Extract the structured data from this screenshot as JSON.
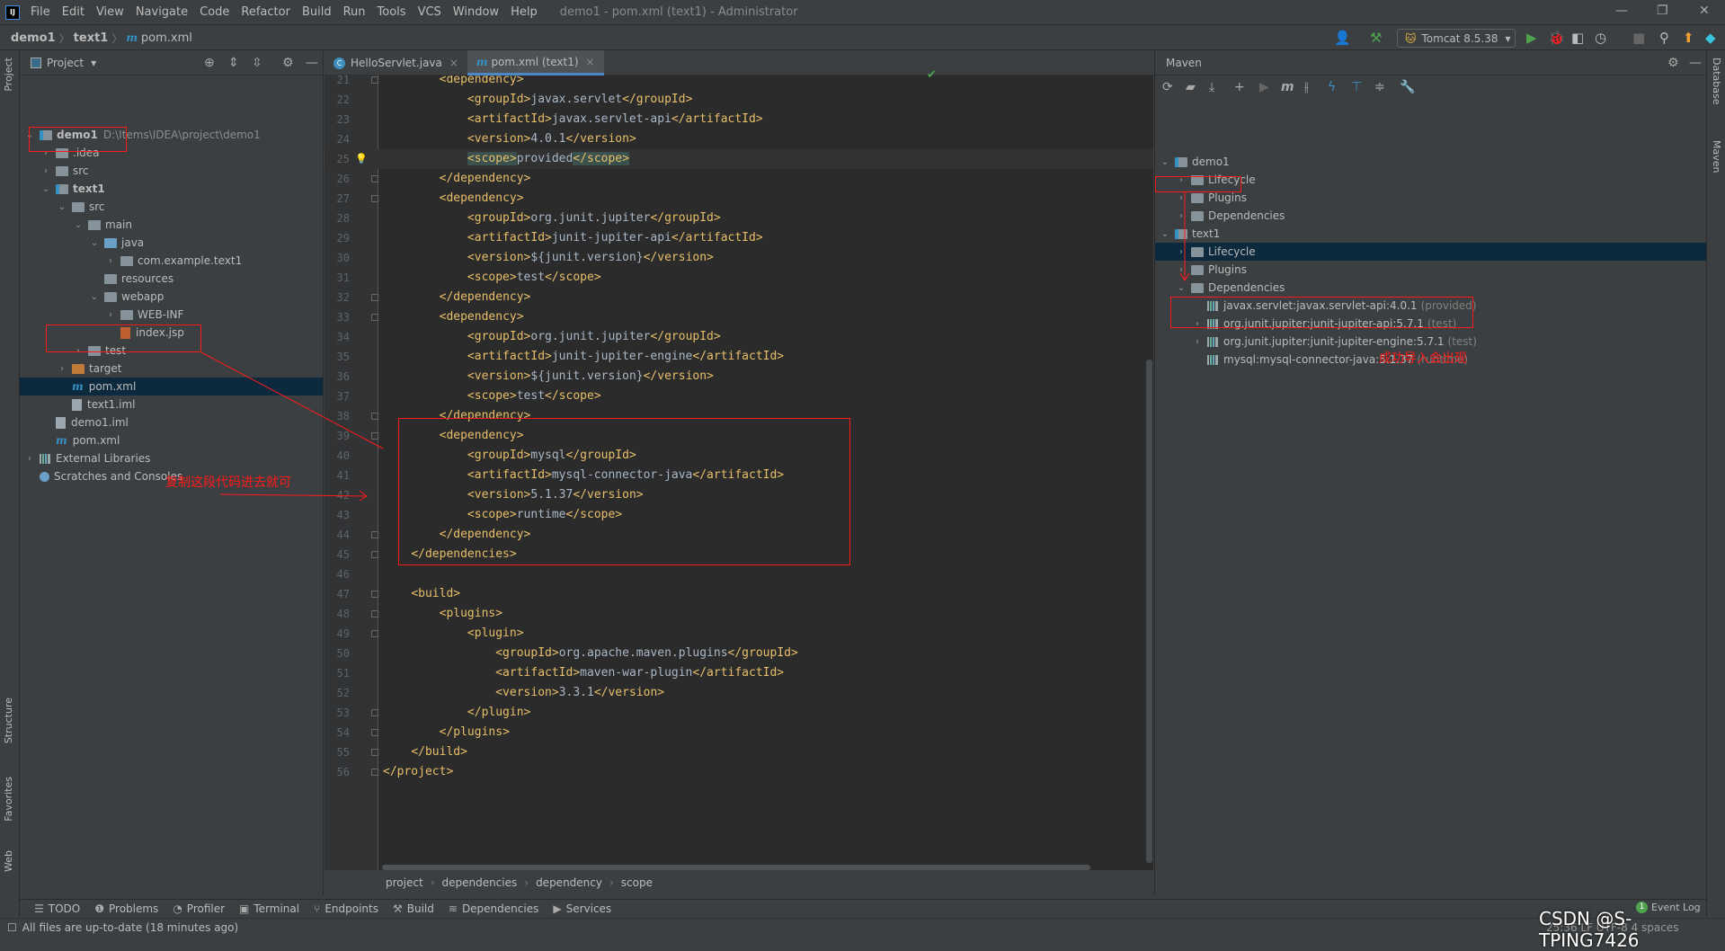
{
  "title_bar": {
    "menu": [
      "File",
      "Edit",
      "View",
      "Navigate",
      "Code",
      "Refactor",
      "Build",
      "Run",
      "Tools",
      "VCS",
      "Window",
      "Help"
    ],
    "window_title": "demo1 - pom.xml (text1) - Administrator",
    "logo": "IJ"
  },
  "nav": {
    "crumbs": [
      "demo1",
      "text1",
      "pom.xml"
    ],
    "run_config": "Tomcat 8.5.38"
  },
  "left_stripe": [
    "Project",
    "Structure",
    "Favorites",
    "Web"
  ],
  "right_stripe": [
    "Database",
    "Maven"
  ],
  "project": {
    "title": "Project",
    "tree": [
      {
        "d": 0,
        "a": "open",
        "label": "demo1",
        "icon": "mod",
        "bold": true,
        "extra": "D:\\Items\\IDEA\\project\\demo1"
      },
      {
        "d": 1,
        "a": "closed",
        "label": ".idea",
        "icon": "folder"
      },
      {
        "d": 1,
        "a": "closed",
        "label": "src",
        "icon": "folder"
      },
      {
        "d": 1,
        "a": "open",
        "label": "text1",
        "icon": "mod",
        "bold": true
      },
      {
        "d": 2,
        "a": "open",
        "label": "src",
        "icon": "folder"
      },
      {
        "d": 3,
        "a": "open",
        "label": "main",
        "icon": "folder"
      },
      {
        "d": 4,
        "a": "open",
        "label": "java",
        "icon": "blue"
      },
      {
        "d": 5,
        "a": "closed",
        "label": "com.example.text1",
        "icon": "folder"
      },
      {
        "d": 4,
        "a": "none",
        "label": "resources",
        "icon": "folder"
      },
      {
        "d": 4,
        "a": "open",
        "label": "webapp",
        "icon": "folder"
      },
      {
        "d": 5,
        "a": "closed",
        "label": "WEB-INF",
        "icon": "folder"
      },
      {
        "d": 5,
        "a": "none",
        "label": "index.jsp",
        "icon": "jsp"
      },
      {
        "d": 3,
        "a": "closed",
        "label": "test",
        "icon": "folder"
      },
      {
        "d": 2,
        "a": "closed",
        "label": "target",
        "icon": "orange"
      },
      {
        "d": 2,
        "a": "none",
        "label": "pom.xml",
        "icon": "maven",
        "selected": true
      },
      {
        "d": 2,
        "a": "none",
        "label": "text1.iml",
        "icon": "iml"
      },
      {
        "d": 1,
        "a": "none",
        "label": "demo1.iml",
        "icon": "iml"
      },
      {
        "d": 1,
        "a": "none",
        "label": "pom.xml",
        "icon": "maven"
      },
      {
        "d": 0,
        "a": "closed",
        "label": "External Libraries",
        "icon": "lib"
      },
      {
        "d": 0,
        "a": "none",
        "label": "Scratches and Consoles",
        "icon": "scratch"
      }
    ]
  },
  "editor": {
    "tabs": [
      {
        "label": "HelloServlet.java",
        "icon": "class-icon"
      },
      {
        "label": "pom.xml (text1)",
        "icon": "maven-icon",
        "active": true
      }
    ],
    "current_line": 25,
    "lines": [
      {
        "n": 21,
        "t": "        <dependency>"
      },
      {
        "n": 22,
        "t": "            <groupId>javax.servlet</groupId>"
      },
      {
        "n": 23,
        "t": "            <artifactId>javax.servlet-api</artifactId>"
      },
      {
        "n": 24,
        "t": "            <version>4.0.1</version>"
      },
      {
        "n": 25,
        "t": "            <scope>provided</scope>"
      },
      {
        "n": 26,
        "t": "        </dependency>"
      },
      {
        "n": 27,
        "t": "        <dependency>"
      },
      {
        "n": 28,
        "t": "            <groupId>org.junit.jupiter</groupId>"
      },
      {
        "n": 29,
        "t": "            <artifactId>junit-jupiter-api</artifactId>"
      },
      {
        "n": 30,
        "t": "            <version>${junit.version}</version>"
      },
      {
        "n": 31,
        "t": "            <scope>test</scope>"
      },
      {
        "n": 32,
        "t": "        </dependency>"
      },
      {
        "n": 33,
        "t": "        <dependency>"
      },
      {
        "n": 34,
        "t": "            <groupId>org.junit.jupiter</groupId>"
      },
      {
        "n": 35,
        "t": "            <artifactId>junit-jupiter-engine</artifactId>"
      },
      {
        "n": 36,
        "t": "            <version>${junit.version}</version>"
      },
      {
        "n": 37,
        "t": "            <scope>test</scope>"
      },
      {
        "n": 38,
        "t": "        </dependency>"
      },
      {
        "n": 39,
        "t": "        <dependency>"
      },
      {
        "n": 40,
        "t": "            <groupId>mysql</groupId>"
      },
      {
        "n": 41,
        "t": "            <artifactId>mysql-connector-java</artifactId>"
      },
      {
        "n": 42,
        "t": "            <version>5.1.37</version>"
      },
      {
        "n": 43,
        "t": "            <scope>runtime</scope>"
      },
      {
        "n": 44,
        "t": "        </dependency>"
      },
      {
        "n": 45,
        "t": "    </dependencies>"
      },
      {
        "n": 46,
        "t": ""
      },
      {
        "n": 47,
        "t": "    <build>"
      },
      {
        "n": 48,
        "t": "        <plugins>"
      },
      {
        "n": 49,
        "t": "            <plugin>"
      },
      {
        "n": 50,
        "t": "                <groupId>org.apache.maven.plugins</groupId>"
      },
      {
        "n": 51,
        "t": "                <artifactId>maven-war-plugin</artifactId>"
      },
      {
        "n": 52,
        "t": "                <version>3.3.1</version>"
      },
      {
        "n": 53,
        "t": "            </plugin>"
      },
      {
        "n": 54,
        "t": "        </plugins>"
      },
      {
        "n": 55,
        "t": "    </build>"
      },
      {
        "n": 56,
        "t": "</project>"
      }
    ],
    "breadcrumb": [
      "project",
      "dependencies",
      "dependency",
      "scope"
    ]
  },
  "maven": {
    "title": "Maven",
    "tree": [
      {
        "d": 0,
        "a": "open",
        "label": "demo1",
        "icon": "mod"
      },
      {
        "d": 1,
        "a": "closed",
        "label": "Lifecycle",
        "icon": "folder"
      },
      {
        "d": 1,
        "a": "closed",
        "label": "Plugins",
        "icon": "folder"
      },
      {
        "d": 1,
        "a": "closed",
        "label": "Dependencies",
        "icon": "folder"
      },
      {
        "d": 0,
        "a": "open",
        "label": "text1",
        "icon": "mod"
      },
      {
        "d": 1,
        "a": "closed",
        "label": "Lifecycle",
        "icon": "folder",
        "selected": true
      },
      {
        "d": 1,
        "a": "closed",
        "label": "Plugins",
        "icon": "folder"
      },
      {
        "d": 1,
        "a": "open",
        "label": "Dependencies",
        "icon": "folder"
      },
      {
        "d": 2,
        "a": "none",
        "label": "javax.servlet:javax.servlet-api:4.0.1",
        "icon": "dep",
        "scope": "(provided)"
      },
      {
        "d": 2,
        "a": "closed",
        "label": "org.junit.jupiter:junit-jupiter-api:5.7.1",
        "icon": "dep",
        "scope": "(test)"
      },
      {
        "d": 2,
        "a": "closed",
        "label": "org.junit.jupiter:junit-jupiter-engine:5.7.1",
        "icon": "dep",
        "scope": "(test)"
      },
      {
        "d": 2,
        "a": "none",
        "label": "mysql:mysql-connector-java:5.1.37",
        "icon": "dep",
        "scope": "(runtime)"
      }
    ]
  },
  "annotations": {
    "copy_note": "复制这段代码进去就可",
    "success_note": "成功导入会出现",
    "color": "#ff1a1a"
  },
  "tool_windows": [
    "TODO",
    "Problems",
    "Profiler",
    "Terminal",
    "Endpoints",
    "Build",
    "Dependencies",
    "Services"
  ],
  "event_log": {
    "label": "Event Log",
    "count": "1"
  },
  "status": {
    "message": "All files are up-to-date (18 minutes ago)",
    "right": "25:36  LF  UTF-8  4 spaces"
  },
  "watermark": "CSDN @S-TPING7426",
  "colors": {
    "background": "#3c3f41",
    "editor": "#2b2b2b",
    "tag": "#e8bf6a",
    "text": "#a9b7c6",
    "accent": "#4a88c7",
    "selection": "#0d293e"
  }
}
